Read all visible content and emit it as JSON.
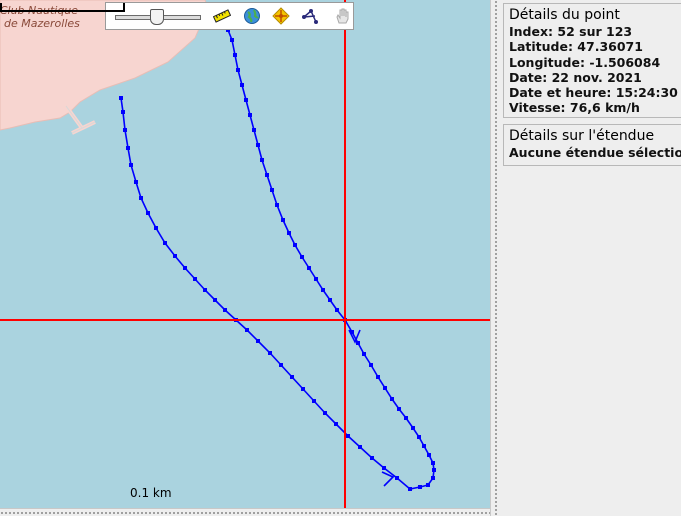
{
  "map": {
    "land_label_line1": "Club Nautique",
    "land_label_line2": "de Mazerolles",
    "scale_label": "0.1 km",
    "colors": {
      "water": "#aad3df",
      "land": "#f7d5d0",
      "track": "#0000ff",
      "crosshair": "#ff0000"
    }
  },
  "toolbar": {
    "icons": [
      "zoom-slider",
      "ruler-icon",
      "globe-icon",
      "compass-icon",
      "connect-points-icon",
      "hand-icon"
    ]
  },
  "point_details": {
    "title": "Détails du point",
    "index": "Index: 52 sur 123",
    "latitude": "Latitude: 47.36071",
    "longitude": "Longitude: -1.506084",
    "date": "Date: 22 nov. 2021",
    "datetime": "Date et heure: 15:24:30",
    "speed": "Vitesse: 76,6 km/h"
  },
  "range_details": {
    "title": "Détails sur l'étendue",
    "status": "Aucune étendue sélectionnée"
  }
}
